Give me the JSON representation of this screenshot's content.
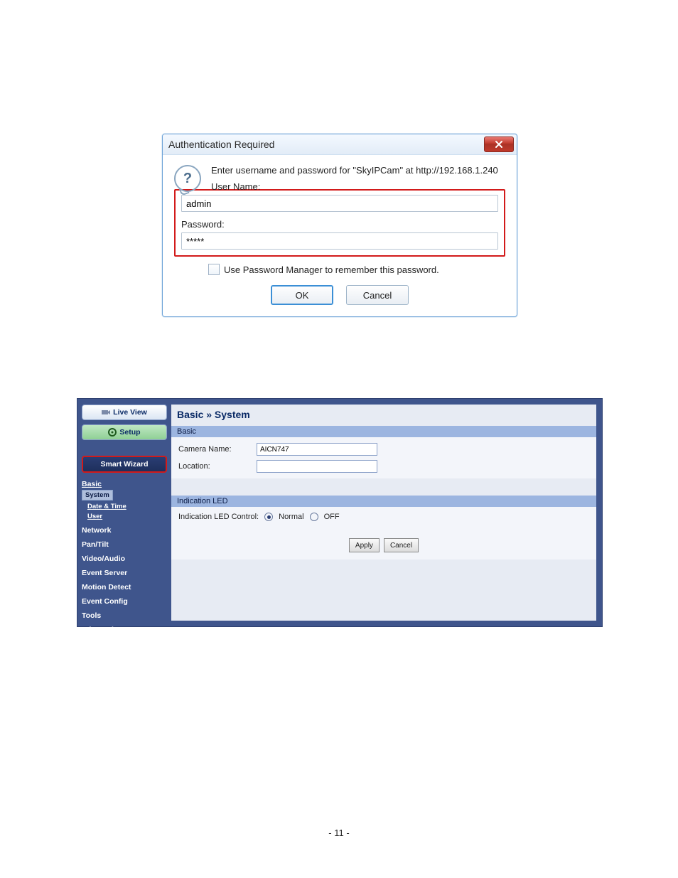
{
  "auth_dialog": {
    "title": "Authentication Required",
    "prompt": "Enter username and password for \"SkyIPCam\" at http://192.168.1.240",
    "username_label": "User Name:",
    "username_value": "admin",
    "password_label": "Password:",
    "password_value": "*****",
    "remember_label": "Use Password Manager to remember this password.",
    "ok_label": "OK",
    "cancel_label": "Cancel"
  },
  "camera_ui": {
    "sidebar": {
      "live_view": "Live View",
      "setup": "Setup",
      "smart_wizard": "Smart Wizard",
      "basic_heading": "Basic",
      "basic_sub": {
        "system": "System",
        "date_time": "Date & Time",
        "user": "User"
      },
      "items": [
        "Network",
        "Pan/Tilt",
        "Video/Audio",
        "Event Server",
        "Motion Detect",
        "Event Config",
        "Tools",
        "Information"
      ]
    },
    "main": {
      "breadcrumb": "Basic » System",
      "sections": {
        "basic": {
          "title": "Basic",
          "camera_name_label": "Camera Name:",
          "camera_name_value": "AICN747",
          "location_label": "Location:",
          "location_value": ""
        },
        "led": {
          "title": "Indication LED",
          "control_label": "Indication LED Control:",
          "options": {
            "normal": "Normal",
            "off": "OFF"
          },
          "selected": "normal"
        }
      },
      "buttons": {
        "apply": "Apply",
        "cancel": "Cancel"
      }
    }
  },
  "page_number": "- 11 -"
}
